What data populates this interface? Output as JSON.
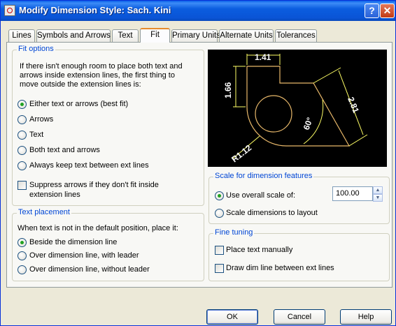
{
  "window": {
    "title": "Modify Dimension Style: Sach. Kini",
    "help_label": "?",
    "close_label": "✕"
  },
  "tabs": [
    {
      "label": "Lines"
    },
    {
      "label": "Symbols and Arrows"
    },
    {
      "label": "Text"
    },
    {
      "label": "Fit",
      "active": true
    },
    {
      "label": "Primary Units"
    },
    {
      "label": "Alternate Units"
    },
    {
      "label": "Tolerances"
    }
  ],
  "fit_options": {
    "title": "Fit options",
    "description_lines": [
      "If there isn't enough room to place both text and",
      "arrows inside extension lines, the first thing to",
      "move outside the extension lines is:"
    ],
    "options": [
      {
        "label": "Either text or arrows (best fit)",
        "checked": true
      },
      {
        "label": "Arrows",
        "checked": false
      },
      {
        "label": "Text",
        "checked": false
      },
      {
        "label": "Both text and arrows",
        "checked": false
      },
      {
        "label": "Always keep text between ext lines",
        "checked": false
      }
    ],
    "suppress_lines": [
      "Suppress arrows if they don't fit inside",
      "extension lines"
    ],
    "suppress_checked": false
  },
  "text_placement": {
    "title": "Text placement",
    "description": "When text is not in the default position, place it:",
    "options": [
      {
        "label": "Beside the dimension line",
        "checked": true
      },
      {
        "label": "Over dimension line, with leader",
        "checked": false
      },
      {
        "label": "Over dimension line, without leader",
        "checked": false
      }
    ]
  },
  "preview": {
    "dim_top": "1.41",
    "dim_left": "1.66",
    "dim_right": "2.81",
    "dim_angle": "60°",
    "dim_radius": "R1.12",
    "colors": {
      "geometry": "#e8b86a",
      "dimensions": "#ffff66",
      "text": "#ffffff"
    }
  },
  "scale": {
    "title": "Scale for dimension features",
    "use_overall_label": "Use overall scale of:",
    "use_overall_checked": true,
    "value": "100.00",
    "layout_label": "Scale dimensions to layout",
    "layout_checked": false
  },
  "fine_tuning": {
    "title": "Fine tuning",
    "place_manually_label": "Place text manually",
    "place_manually_checked": false,
    "draw_dim_line_label": "Draw dim line between ext lines",
    "draw_dim_line_checked": false
  },
  "buttons": {
    "ok": "OK",
    "cancel": "Cancel",
    "help": "Help"
  }
}
